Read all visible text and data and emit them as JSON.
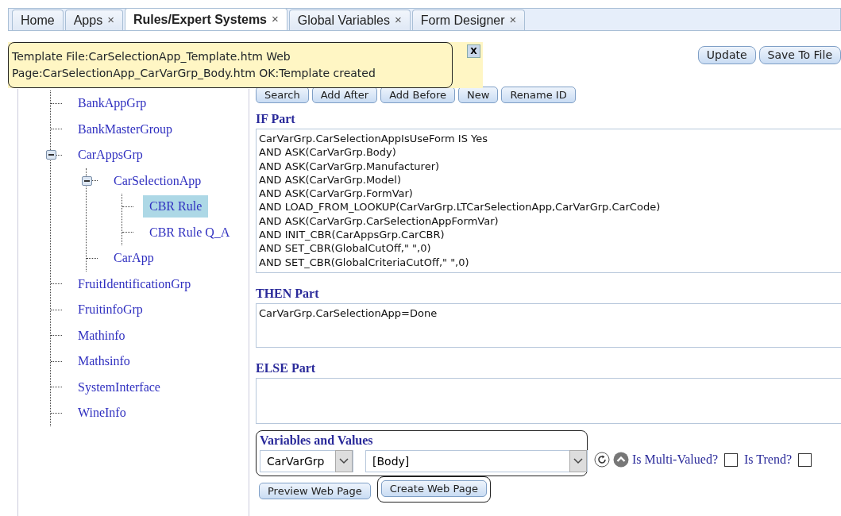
{
  "tabs": [
    {
      "label": "Home",
      "selected": false
    },
    {
      "label": "Apps",
      "selected": false,
      "close": "×"
    },
    {
      "label": "Rules/Expert Systems",
      "selected": true,
      "close": "×"
    },
    {
      "label": "Global Variables",
      "selected": false,
      "close": "×"
    },
    {
      "label": "Form Designer",
      "selected": false,
      "close": "×"
    }
  ],
  "notification": {
    "text": "Template File:CarSelectionApp_Template.htm Web Page:CarSelectionApp_CarVarGrp_Body.htm OK:Template created",
    "close": "X"
  },
  "top_buttons": [
    "Update",
    "Save To File"
  ],
  "tree": [
    {
      "label": "BankAppGrp",
      "selected": false
    },
    {
      "label": "BankMasterGroup",
      "selected": false
    },
    {
      "label": "CarAppsGrp",
      "selected": false,
      "expanded": true,
      "children": [
        {
          "label": "CarSelectionApp",
          "selected": false,
          "expanded": true,
          "children": [
            {
              "label": "CBR Rule",
              "selected": true
            },
            {
              "label": "CBR Rule Q_A",
              "selected": false
            }
          ]
        },
        {
          "label": "CarApp",
          "selected": false
        }
      ]
    },
    {
      "label": "FruitIdentificationGrp",
      "selected": false
    },
    {
      "label": "FruitinfoGrp",
      "selected": false
    },
    {
      "label": "Mathinfo",
      "selected": false
    },
    {
      "label": "Mathsinfo",
      "selected": false
    },
    {
      "label": "SystemInterface",
      "selected": false
    },
    {
      "label": "WineInfo",
      "selected": false
    }
  ],
  "toolbar": [
    "Search",
    "Add After",
    "Add Before",
    "New",
    "Rename ID"
  ],
  "if_part": {
    "label": "IF Part",
    "lines": [
      "CarVarGrp.CarSelectionAppIsUseForm IS Yes",
      "AND ASK(CarVarGrp.Body)",
      "AND ASK(CarVarGrp.Manufacturer)",
      "AND ASK(CarVarGrp.Model)",
      "AND ASK(CarVarGrp.FormVar)",
      "AND LOAD_FROM_LOOKUP(CarVarGrp.LTCarSelectionApp,CarVarGrp.CarCode)",
      "AND ASK(CarVarGrp.CarSelectionAppFormVar)",
      "AND INIT_CBR(CarAppsGrp.CarCBR)",
      "AND SET_CBR(GlobalCutOff,\" \",0)",
      "AND SET_CBR(GlobalCriteriaCutOff,\" \",0)"
    ]
  },
  "then_part": {
    "label": "THEN Part",
    "lines": [
      "CarVarGrp.CarSelectionApp=Done"
    ]
  },
  "else_part": {
    "label": "ELSE Part"
  },
  "variables": {
    "label": "Variables and Values",
    "outlined": true,
    "group": "CarVarGrp",
    "variable": "[Body]",
    "multi_valued": {
      "label": "Is Multi-Valued?",
      "checked": false
    },
    "trend": {
      "label": "Is Trend?",
      "checked": false
    }
  },
  "bottom_buttons": [
    {
      "label": "Preview Web Page",
      "outlined": false
    },
    {
      "label": "Create Web Page",
      "outlined": true
    }
  ]
}
